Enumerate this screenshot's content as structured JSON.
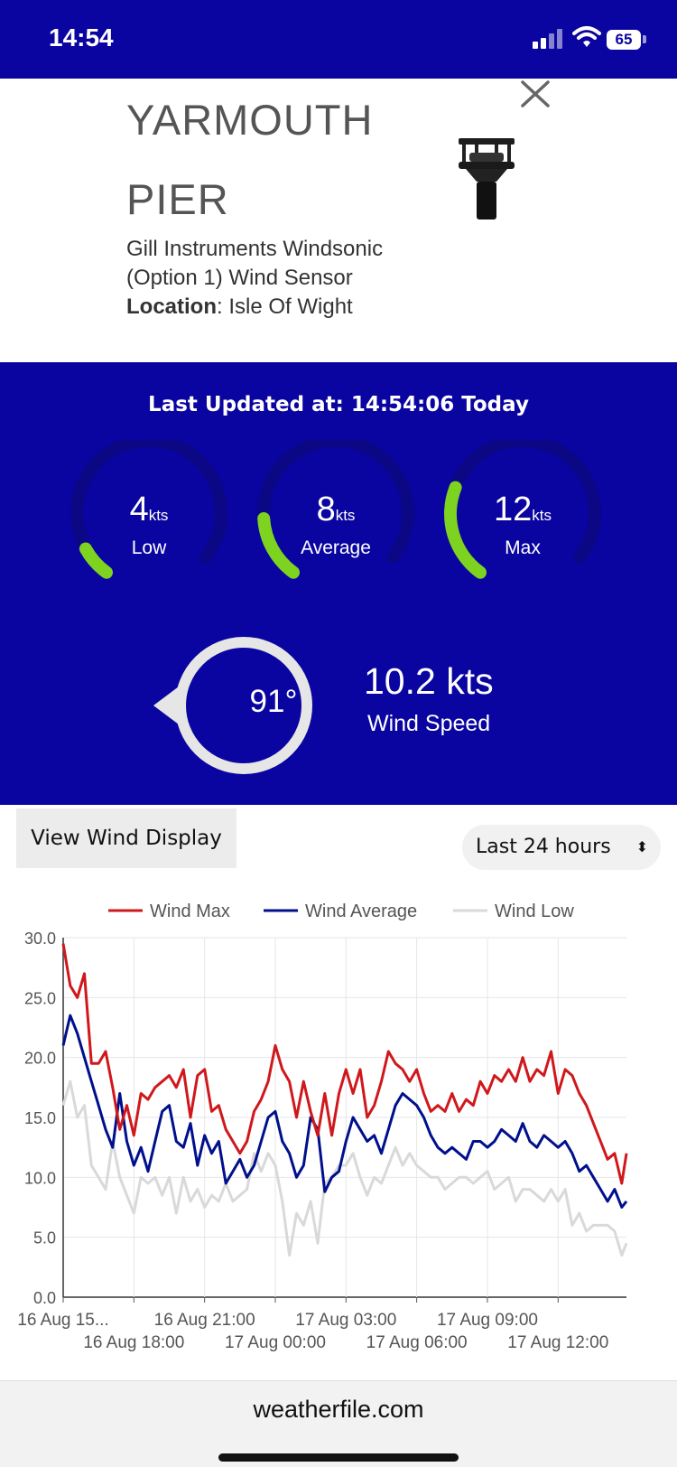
{
  "status_bar": {
    "time": "14:54",
    "battery": "65"
  },
  "station": {
    "title": "YARMOUTH PIER",
    "sensor": "Gill Instruments Windsonic (Option 1) Wind Sensor",
    "location_label": "Location",
    "location_value": ": Isle Of Wight"
  },
  "live": {
    "last_updated": "Last Updated at: 14:54:06 Today",
    "unit": "kts",
    "gauges": [
      {
        "value": "4",
        "label": "Low",
        "level": 0.1
      },
      {
        "value": "8",
        "label": "Average",
        "level": 0.2
      },
      {
        "value": "12",
        "label": "Max",
        "level": 0.3
      }
    ],
    "direction": "91°",
    "wind_speed_value": "10.2 kts",
    "wind_speed_label": "Wind Speed",
    "accent_color": "#7ed321",
    "panel_color": "#0a05a0"
  },
  "controls": {
    "view_button": "View Wind Display",
    "range_selected": "Last 24 hours"
  },
  "chart_data": {
    "type": "line",
    "legend": [
      "Wind Max",
      "Wind Average",
      "Wind Low"
    ],
    "legend_position": "top",
    "ylim": [
      0,
      30
    ],
    "y_ticks": [
      "0.0",
      "5.0",
      "10.0",
      "15.0",
      "20.0",
      "25.0",
      "30.0"
    ],
    "x_tick_labels": [
      "16 Aug 15...",
      "16 Aug 18:00",
      "16 Aug 21:00",
      "17 Aug 00:00",
      "17 Aug 03:00",
      "17 Aug 06:00",
      "17 Aug 09:00",
      "17 Aug 12:00"
    ],
    "x_hours": [
      0,
      3,
      6,
      9,
      12,
      15,
      18,
      21
    ],
    "x_max_hours": 23.9,
    "grid": true,
    "series": [
      {
        "name": "Wind Max",
        "color": "#d0181c",
        "x": [
          0,
          0.3,
          0.6,
          0.9,
          1.2,
          1.5,
          1.8,
          2.1,
          2.4,
          2.7,
          3.0,
          3.3,
          3.6,
          3.9,
          4.2,
          4.5,
          4.8,
          5.1,
          5.4,
          5.7,
          6.0,
          6.3,
          6.6,
          6.9,
          7.2,
          7.5,
          7.8,
          8.1,
          8.4,
          8.7,
          9.0,
          9.3,
          9.6,
          9.9,
          10.2,
          10.5,
          10.8,
          11.1,
          11.4,
          11.7,
          12.0,
          12.3,
          12.6,
          12.9,
          13.2,
          13.5,
          13.8,
          14.1,
          14.4,
          14.7,
          15.0,
          15.3,
          15.6,
          15.9,
          16.2,
          16.5,
          16.8,
          17.1,
          17.4,
          17.7,
          18.0,
          18.3,
          18.6,
          18.9,
          19.2,
          19.5,
          19.8,
          20.1,
          20.4,
          20.7,
          21.0,
          21.3,
          21.6,
          21.9,
          22.2,
          22.5,
          22.8,
          23.1,
          23.4,
          23.7,
          23.9
        ],
        "y": [
          29.5,
          26,
          25,
          27,
          19.5,
          19.5,
          20.5,
          17.5,
          14,
          16,
          13.5,
          17,
          16.5,
          17.5,
          18,
          18.5,
          17.5,
          19,
          15,
          18.5,
          19,
          15.5,
          16,
          14,
          13,
          12,
          13,
          15.5,
          16.5,
          18,
          21,
          19,
          18,
          15,
          18,
          15.5,
          13.5,
          17,
          13.5,
          17,
          19,
          17,
          19,
          15,
          16,
          18,
          20.5,
          19.5,
          19,
          18,
          19,
          17,
          15.5,
          16,
          15.5,
          17,
          15.5,
          16.5,
          16,
          18,
          17,
          18.5,
          18,
          19,
          18,
          20,
          18,
          19,
          18.5,
          20.5,
          17,
          19,
          18.5,
          17,
          16,
          14.5,
          13,
          11.5,
          12,
          9.5,
          12
        ]
      },
      {
        "name": "Wind Average",
        "color": "#00108c",
        "x": [
          0,
          0.3,
          0.6,
          0.9,
          1.2,
          1.5,
          1.8,
          2.1,
          2.4,
          2.7,
          3.0,
          3.3,
          3.6,
          3.9,
          4.2,
          4.5,
          4.8,
          5.1,
          5.4,
          5.7,
          6.0,
          6.3,
          6.6,
          6.9,
          7.2,
          7.5,
          7.8,
          8.1,
          8.4,
          8.7,
          9.0,
          9.3,
          9.6,
          9.9,
          10.2,
          10.5,
          10.8,
          11.1,
          11.4,
          11.7,
          12.0,
          12.3,
          12.6,
          12.9,
          13.2,
          13.5,
          13.8,
          14.1,
          14.4,
          14.7,
          15.0,
          15.3,
          15.6,
          15.9,
          16.2,
          16.5,
          16.8,
          17.1,
          17.4,
          17.7,
          18.0,
          18.3,
          18.6,
          18.9,
          19.2,
          19.5,
          19.8,
          20.1,
          20.4,
          20.7,
          21.0,
          21.3,
          21.6,
          21.9,
          22.2,
          22.5,
          22.8,
          23.1,
          23.4,
          23.7,
          23.9
        ],
        "y": [
          21,
          23.5,
          22,
          20,
          18,
          16,
          14,
          12.5,
          17,
          13,
          11,
          12.5,
          10.5,
          13,
          15.5,
          16,
          13,
          12.5,
          14.5,
          11,
          13.5,
          12,
          13,
          9.5,
          10.5,
          11.5,
          10,
          11,
          13,
          15,
          15.5,
          13,
          12,
          10,
          11,
          15,
          14,
          8.8,
          10,
          10.5,
          13,
          15,
          14,
          13,
          13.5,
          12,
          14,
          16,
          17,
          16.5,
          16,
          15,
          13.5,
          12.5,
          12,
          12.5,
          12,
          11.5,
          13,
          13,
          12.5,
          13,
          14,
          13.5,
          13,
          14.5,
          13,
          12.5,
          13.5,
          13,
          12.5,
          13,
          12,
          10.5,
          11,
          10,
          9,
          8,
          9,
          7.5,
          8
        ]
      },
      {
        "name": "Wind Low",
        "color": "#d9d9d9",
        "x": [
          0,
          0.3,
          0.6,
          0.9,
          1.2,
          1.5,
          1.8,
          2.1,
          2.4,
          2.7,
          3.0,
          3.3,
          3.6,
          3.9,
          4.2,
          4.5,
          4.8,
          5.1,
          5.4,
          5.7,
          6.0,
          6.3,
          6.6,
          6.9,
          7.2,
          7.5,
          7.8,
          8.1,
          8.4,
          8.7,
          9.0,
          9.3,
          9.6,
          9.9,
          10.2,
          10.5,
          10.8,
          11.1,
          11.4,
          11.7,
          12.0,
          12.3,
          12.6,
          12.9,
          13.2,
          13.5,
          13.8,
          14.1,
          14.4,
          14.7,
          15.0,
          15.3,
          15.6,
          15.9,
          16.2,
          16.5,
          16.8,
          17.1,
          17.4,
          17.7,
          18.0,
          18.3,
          18.6,
          18.9,
          19.2,
          19.5,
          19.8,
          20.1,
          20.4,
          20.7,
          21.0,
          21.3,
          21.6,
          21.9,
          22.2,
          22.5,
          22.8,
          23.1,
          23.4,
          23.7,
          23.9
        ],
        "y": [
          16,
          18,
          15,
          16,
          11,
          10,
          9,
          13,
          10,
          8.5,
          7,
          10,
          9.5,
          10,
          8.5,
          10,
          7,
          10,
          8,
          9,
          7.5,
          8.5,
          8,
          9.5,
          8,
          8.5,
          9,
          12,
          10.5,
          12,
          11,
          8,
          3.5,
          7,
          6,
          8,
          4.5,
          9.5,
          10,
          11,
          11,
          12,
          10,
          8.5,
          10,
          9.5,
          11,
          12.5,
          11,
          12,
          11,
          10.5,
          10,
          10,
          9,
          9.5,
          10,
          10,
          9.5,
          10,
          10.5,
          9,
          9.5,
          10,
          8,
          9,
          9,
          8.5,
          8,
          9,
          8,
          9,
          6,
          7,
          5.5,
          6,
          6,
          6,
          5.5,
          3.5,
          4.5
        ]
      }
    ]
  },
  "footer": {
    "url": "weatherfile.com"
  }
}
